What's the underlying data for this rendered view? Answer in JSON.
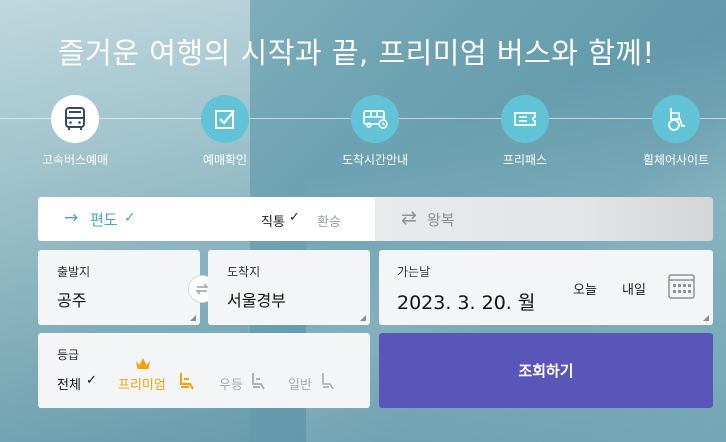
{
  "headline": "즐거운 여행의 시작과 끝, 프리미엄 버스와 함께!",
  "nav": {
    "items": [
      {
        "label": "고속버스예매",
        "icon": "bus-icon",
        "active": true
      },
      {
        "label": "예매확인",
        "icon": "checkbox-icon",
        "active": false
      },
      {
        "label": "도착시간안내",
        "icon": "bus-clock-icon",
        "active": false
      },
      {
        "label": "프리패스",
        "icon": "ticket-icon",
        "active": false
      },
      {
        "label": "휠체어사이트",
        "icon": "wheelchair-icon",
        "active": false
      }
    ]
  },
  "trip": {
    "oneway_label": "편도",
    "oneway_check": "✓",
    "direct_label": "직통",
    "direct_check": "✓",
    "transfer_label": "환승",
    "round_label": "왕복"
  },
  "route": {
    "origin_label": "출발지",
    "origin_value": "공주",
    "dest_label": "도착지",
    "dest_value": "서울경부"
  },
  "date": {
    "label": "가는날",
    "value": "2023. 3. 20. 월",
    "today_label": "오늘",
    "tomorrow_label": "내일"
  },
  "grade": {
    "label": "등급",
    "all_label": "전체",
    "all_check": "✓",
    "premium_label": "프리미엄",
    "superior_label": "우등",
    "standard_label": "일반"
  },
  "search_label": "조회하기",
  "colors": {
    "accent_teal": "#62c3d7",
    "search_purple": "#5a55b8",
    "premium_orange": "#f0a30a"
  }
}
